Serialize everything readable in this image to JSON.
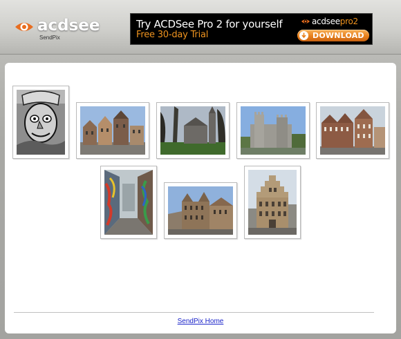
{
  "header": {
    "logo_text": "acdsee",
    "logo_sub": "SendPix",
    "colors": {
      "brand_orange": "#f0941f",
      "banner_bg": "#000000"
    }
  },
  "banner": {
    "headline": "Try ACDSee Pro 2 for yourself",
    "subline": "Free 30-day Trial",
    "brand_text": "acdsee",
    "brand_pro": "pro2",
    "button_label": "DOWNLOAD"
  },
  "gallery": {
    "photos": [
      {
        "subject": "graffiti-face"
      },
      {
        "subject": "town-square-buildings"
      },
      {
        "subject": "church-and-park"
      },
      {
        "subject": "stone-castle"
      },
      {
        "subject": "brick-gabled-building"
      },
      {
        "subject": "graffiti-alley"
      },
      {
        "subject": "ornate-street-facade"
      },
      {
        "subject": "stepped-gable-house"
      }
    ]
  },
  "footer": {
    "link_text": "SendPix Home"
  }
}
